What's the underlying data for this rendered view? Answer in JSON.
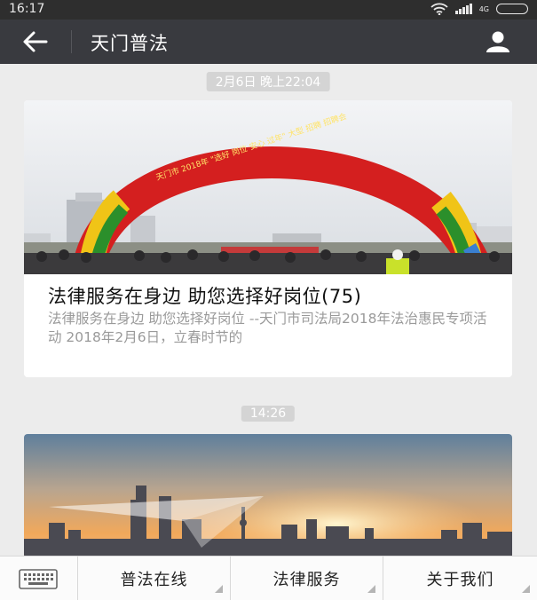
{
  "status_bar": {
    "time": "16:17",
    "network": "4G"
  },
  "header": {
    "title": "天门普法",
    "back_icon": "arrow-left-icon",
    "profile_icon": "person-icon"
  },
  "messages": [
    {
      "timestamp": "2月6日 晚上22:04",
      "title": "法律服务在身边  助您选择好岗位(75)",
      "summary": "法律服务在身边  助您选择好岗位 --天门市司法局2018年法治惠民专项活动 2018年2月6日，立春时节的",
      "image_desc": "crowd under inflatable rainbow arch",
      "arch_text": "天门市 2018年 \"选好 岗位 安心 过年\" 大型 招聘 招聘会"
    },
    {
      "timestamp": "14:26",
      "image_desc": "city skyline at sunset with paper plane"
    }
  ],
  "menu": {
    "keyboard_icon": "keyboard-icon",
    "items": [
      {
        "label": "普法在线"
      },
      {
        "label": "法律服务"
      },
      {
        "label": "关于我们"
      }
    ]
  },
  "colors": {
    "navbar": "#393a3f",
    "statusbar": "#2e2e2e",
    "background": "#ececec",
    "timestamp_bg": "#d4d4d4"
  }
}
